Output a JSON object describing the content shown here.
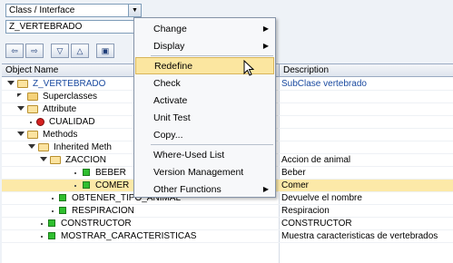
{
  "class_type_select": {
    "value": "Class / Interface"
  },
  "object_name_field": {
    "value": "Z_VERTEBRADO"
  },
  "grid": {
    "col_object": "Object Name",
    "col_description": "Description",
    "rows": [
      {
        "label": "Z_VERTEBRADO",
        "desc": "SubClase vertebrado"
      },
      {
        "label": "Superclasses",
        "desc": ""
      },
      {
        "label": "Attribute",
        "desc": ""
      },
      {
        "label": "CUALIDAD",
        "desc": ""
      },
      {
        "label": "Methods",
        "desc": ""
      },
      {
        "label": "Inherited Meth",
        "desc": ""
      },
      {
        "label": "ZACCION",
        "desc": "Accion de animal"
      },
      {
        "label": "BEBER",
        "desc": "Beber"
      },
      {
        "label": "COMER",
        "desc": "Comer"
      },
      {
        "label": "OBTENER_TIPO_ANIMAL",
        "desc": "Devuelve el nombre"
      },
      {
        "label": "RESPIRACION",
        "desc": "Respiracion"
      },
      {
        "label": "CONSTRUCTOR",
        "desc": "CONSTRUCTOR"
      },
      {
        "label": "MOSTRAR_CARACTERISTICAS",
        "desc": "Muestra caracteristicas de vertebrados"
      }
    ]
  },
  "context_menu": {
    "items": [
      {
        "label": "Change"
      },
      {
        "label": "Display"
      },
      {
        "label": "Redefine"
      },
      {
        "label": "Check"
      },
      {
        "label": "Activate"
      },
      {
        "label": "Unit Test"
      },
      {
        "label": "Copy..."
      },
      {
        "label": "Where-Used List"
      },
      {
        "label": "Version Management"
      },
      {
        "label": "Other Functions"
      }
    ]
  },
  "icons": {
    "dropdown": "chevron-down-icon",
    "back": "arrow-left-icon",
    "forward": "arrow-right-icon",
    "expand": "expand-all-icon",
    "collapse": "collapse-all-icon",
    "submenu": "chevron-right-icon",
    "cursor": "mouse-pointer-icon"
  },
  "colors": {
    "highlight": "#fbe6a0",
    "link_blue": "#1a4aa0",
    "method_icon": "#2fbf2f",
    "attribute_icon": "#d42020"
  }
}
